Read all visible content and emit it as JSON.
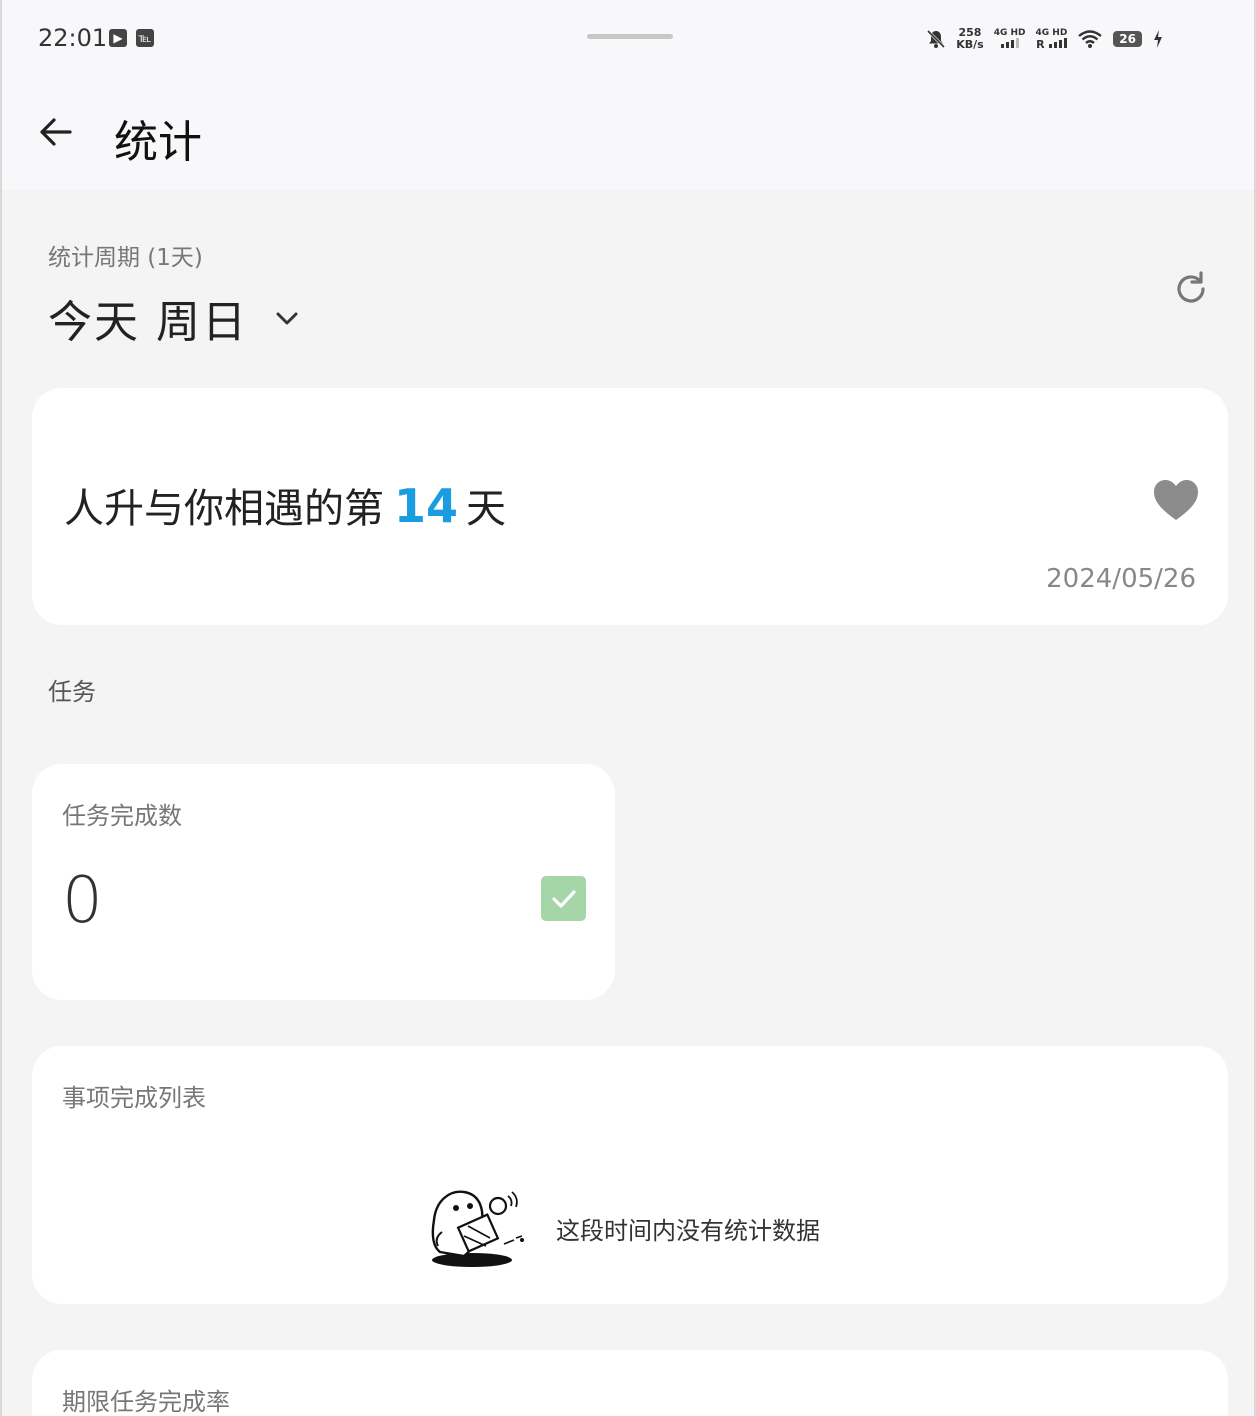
{
  "status_bar": {
    "time": "22:01",
    "net_speed_value": "258",
    "net_speed_unit": "KB/s",
    "sim1_label": "4G HD",
    "sim2_label": "4G HD",
    "roaming": "R",
    "battery": "26"
  },
  "app_bar": {
    "title": "统计"
  },
  "period": {
    "label": "统计周期 (1天)",
    "value": "今天 周日"
  },
  "anniversary": {
    "prefix": "人升与你相遇的第",
    "days": "14",
    "suffix": "天",
    "date": "2024/05/26",
    "accent_color": "#1a9de0"
  },
  "tasks_section": {
    "label": "任务"
  },
  "tasks_card": {
    "title": "任务完成数",
    "count": "0",
    "badge_color": "#a5d6a7"
  },
  "items_card": {
    "title": "事项完成列表",
    "empty_text": "这段时间内没有统计数据"
  },
  "rate_card": {
    "title": "期限任务完成率"
  }
}
